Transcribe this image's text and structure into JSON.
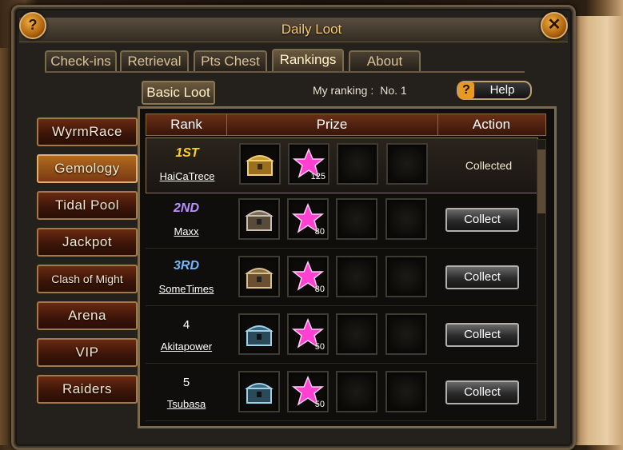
{
  "window": {
    "title": "Daily Loot"
  },
  "tabs": [
    {
      "label": "Check-ins"
    },
    {
      "label": "Retrieval"
    },
    {
      "label": "Pts Chest"
    },
    {
      "label": "Rankings"
    },
    {
      "label": "About"
    }
  ],
  "subtab": {
    "label": "Basic Loot"
  },
  "my_ranking": {
    "label": "My ranking :",
    "value": "No. 1"
  },
  "help": {
    "label": "Help"
  },
  "sidebar": [
    {
      "label": "WyrmRace"
    },
    {
      "label": "Gemology"
    },
    {
      "label": "Tidal Pool"
    },
    {
      "label": "Jackpot"
    },
    {
      "label": "Clash of Might"
    },
    {
      "label": "Arena"
    },
    {
      "label": "VIP"
    },
    {
      "label": "Raiders"
    }
  ],
  "table": {
    "headers": {
      "rank": "Rank",
      "prize": "Prize",
      "action": "Action"
    },
    "rows": [
      {
        "rank": "1ST",
        "player": "HaiCaTrece",
        "chest": "gold-chest",
        "qty": "125",
        "action": "Collected"
      },
      {
        "rank": "2ND",
        "player": "Maxx",
        "chest": "silver-chest",
        "qty": "80",
        "action": "Collect"
      },
      {
        "rank": "3RD",
        "player": "SomeTimes",
        "chest": "silver-chest",
        "qty": "80",
        "action": "Collect"
      },
      {
        "rank": "4",
        "player": "Akitapower",
        "chest": "blue-chest",
        "qty": "50",
        "action": "Collect"
      },
      {
        "rank": "5",
        "player": "Tsubasa",
        "chest": "blue-chest",
        "qty": "50",
        "action": "Collect"
      }
    ]
  },
  "colors": {
    "accent": "#f3c86a",
    "rank1": "#ffd020",
    "rank2": "#b890ff",
    "rank3": "#70b8ff"
  }
}
